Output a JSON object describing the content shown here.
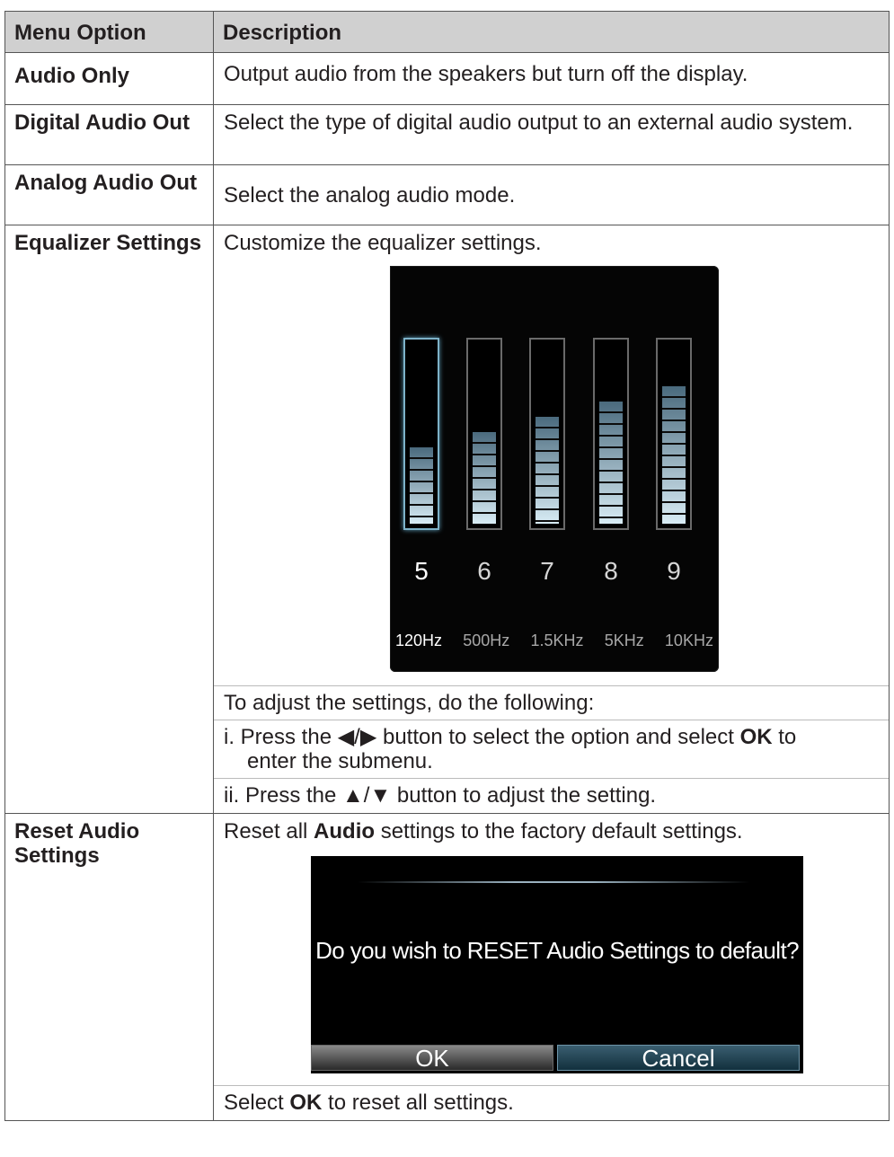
{
  "table": {
    "headers": {
      "option": "Menu Option",
      "description": "Description"
    },
    "rows": [
      {
        "option": "Audio Only",
        "description": "Output audio from the speakers but turn off the display."
      },
      {
        "option": "Digital Audio Out",
        "description": "Select the type of digital audio output to an external audio system."
      },
      {
        "option": "Analog Audio Out",
        "description": "Select the analog audio mode."
      },
      {
        "option": "Equalizer Settings",
        "description": "Customize the equalizer settings.",
        "instructions_intro": "To adjust the settings, do the following:",
        "step1": {
          "prefix": "i. Press the ",
          "arrows": "◀/▶",
          "mid": " button to select the option and select ",
          "ok": "OK",
          "suffix": " to",
          "continuation": "enter the submenu."
        },
        "step2": {
          "prefix": "ii. Press the ",
          "arrows": "▲/▼",
          "suffix": " button to adjust the setting."
        }
      },
      {
        "option": "Reset Audio Settings",
        "description": {
          "prefix": "Reset all ",
          "bold": "Audio",
          "suffix": " settings to the factory default settings."
        },
        "footer": {
          "prefix": "Select ",
          "bold": "OK",
          "suffix": " to reset all settings."
        }
      }
    ]
  },
  "equalizer_screen": {
    "selected_index": 0,
    "bands": [
      {
        "level": 5,
        "frequency": "120Hz"
      },
      {
        "level": 6,
        "frequency": "500Hz"
      },
      {
        "level": 7,
        "frequency": "1.5KHz"
      },
      {
        "level": 8,
        "frequency": "5KHz"
      },
      {
        "level": 9,
        "frequency": "10KHz"
      }
    ],
    "max_level": 12,
    "colors": {
      "frame": "#6a6a6a",
      "selected_frame": "#7db2c8",
      "fill_top": "#4a6a7d",
      "fill_bottom": "#d8ecf5"
    }
  },
  "reset_dialog": {
    "message": "Do you wish to RESET Audio Settings to default?",
    "ok_label": "OK",
    "cancel_label": "Cancel",
    "focused_button": "Cancel"
  }
}
